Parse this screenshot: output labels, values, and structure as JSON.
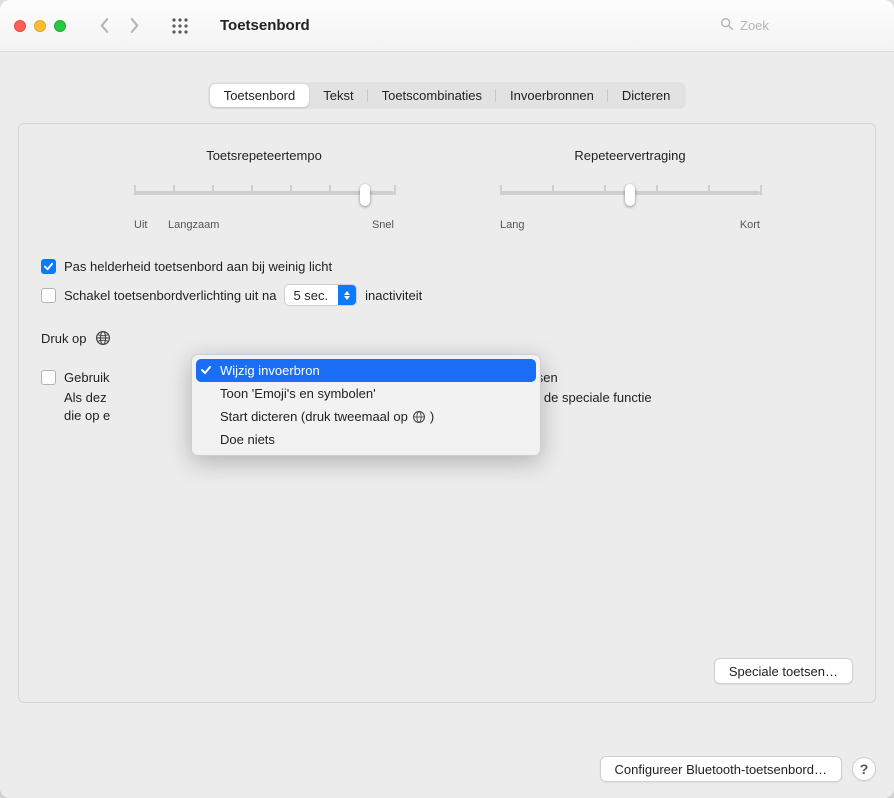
{
  "window": {
    "title": "Toetsenbord",
    "search_placeholder": "Zoek"
  },
  "tabs": [
    {
      "label": "Toetsenbord",
      "active": true
    },
    {
      "label": "Tekst",
      "active": false
    },
    {
      "label": "Toetscombinaties",
      "active": false
    },
    {
      "label": "Invoerbronnen",
      "active": false
    },
    {
      "label": "Dicteren",
      "active": false
    }
  ],
  "sliders": {
    "repeat": {
      "label": "Toetsrepeteertempo",
      "left": "Uit",
      "mid": "Langzaam",
      "right": "Snel",
      "value_pct": 89
    },
    "delay": {
      "label": "Repeteervertraging",
      "left": "Lang",
      "right": "Kort",
      "value_pct": 50
    }
  },
  "options": {
    "brightness_checked": true,
    "brightness_label": "Pas helderheid toetsenbord aan bij weinig licht",
    "backlight_off_checked": false,
    "backlight_off_label_pre": "Schakel toetsenbordverlichting uit na",
    "backlight_off_value": "5 sec.",
    "backlight_off_label_post": "inactiviteit",
    "press_globe_label_pre": "Druk op",
    "fn_checked": false,
    "fn_label": "Gebruik",
    "fn_label_tail": "dfunctietoetsen",
    "fn_hint_pre": "Als dez",
    "fn_hint_mid": "s drukken om de speciale functie",
    "fn_hint_tail": "die op e"
  },
  "menu": {
    "items": [
      {
        "label": "Wijzig invoerbron",
        "selected": true
      },
      {
        "label": "Toon 'Emoji's en symbolen'",
        "selected": false
      },
      {
        "label": "Start dicteren (druk tweemaal op ",
        "trailing_globe": true,
        "tail": " )",
        "selected": false
      },
      {
        "label": "Doe niets",
        "selected": false
      }
    ]
  },
  "buttons": {
    "special_keys": "Speciale toetsen…",
    "bluetooth": "Configureer Bluetooth-toetsenbord…"
  }
}
